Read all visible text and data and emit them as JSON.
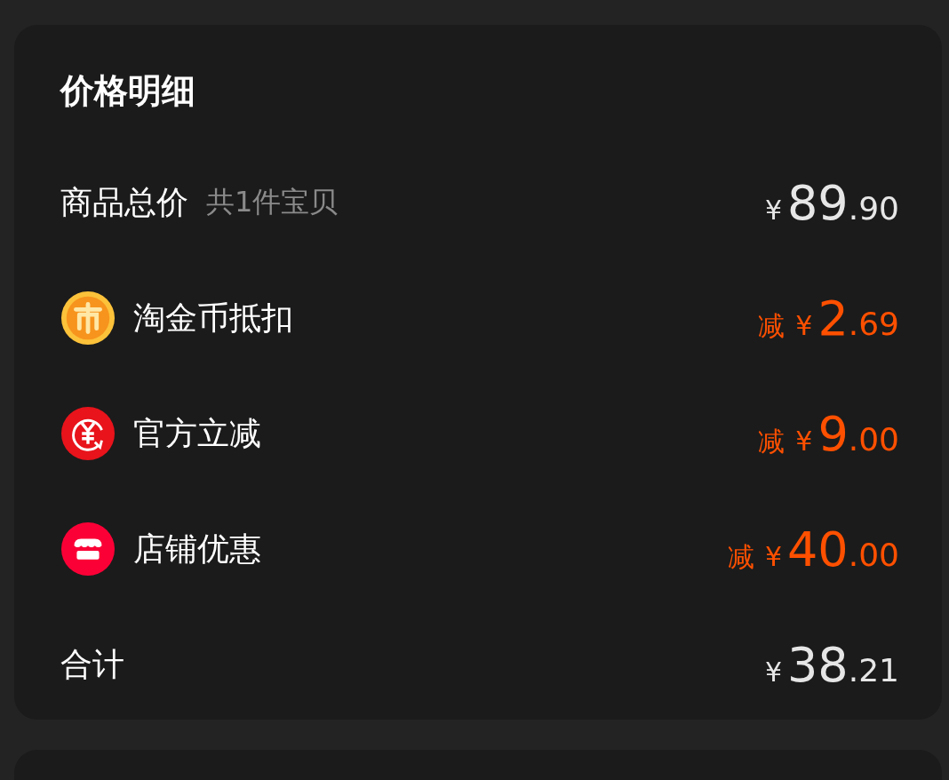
{
  "title": "价格明细",
  "rows": [
    {
      "kind": "subtotal",
      "label": "商品总价",
      "note": "共1件宝贝",
      "currency": "¥",
      "amount": "89",
      "cents": ".90"
    },
    {
      "kind": "coin",
      "label": "淘金币抵扣",
      "prefix": "减",
      "currency": "¥",
      "amount": "2",
      "cents": ".69"
    },
    {
      "kind": "rebate",
      "label": "官方立减",
      "prefix": "减",
      "currency": "¥",
      "amount": "9",
      "cents": ".00"
    },
    {
      "kind": "shop",
      "label": "店铺优惠",
      "prefix": "减",
      "currency": "¥",
      "amount": "40",
      "cents": ".00"
    },
    {
      "kind": "total",
      "label": "合计",
      "currency": "¥",
      "amount": "38",
      "cents": ".21"
    }
  ]
}
